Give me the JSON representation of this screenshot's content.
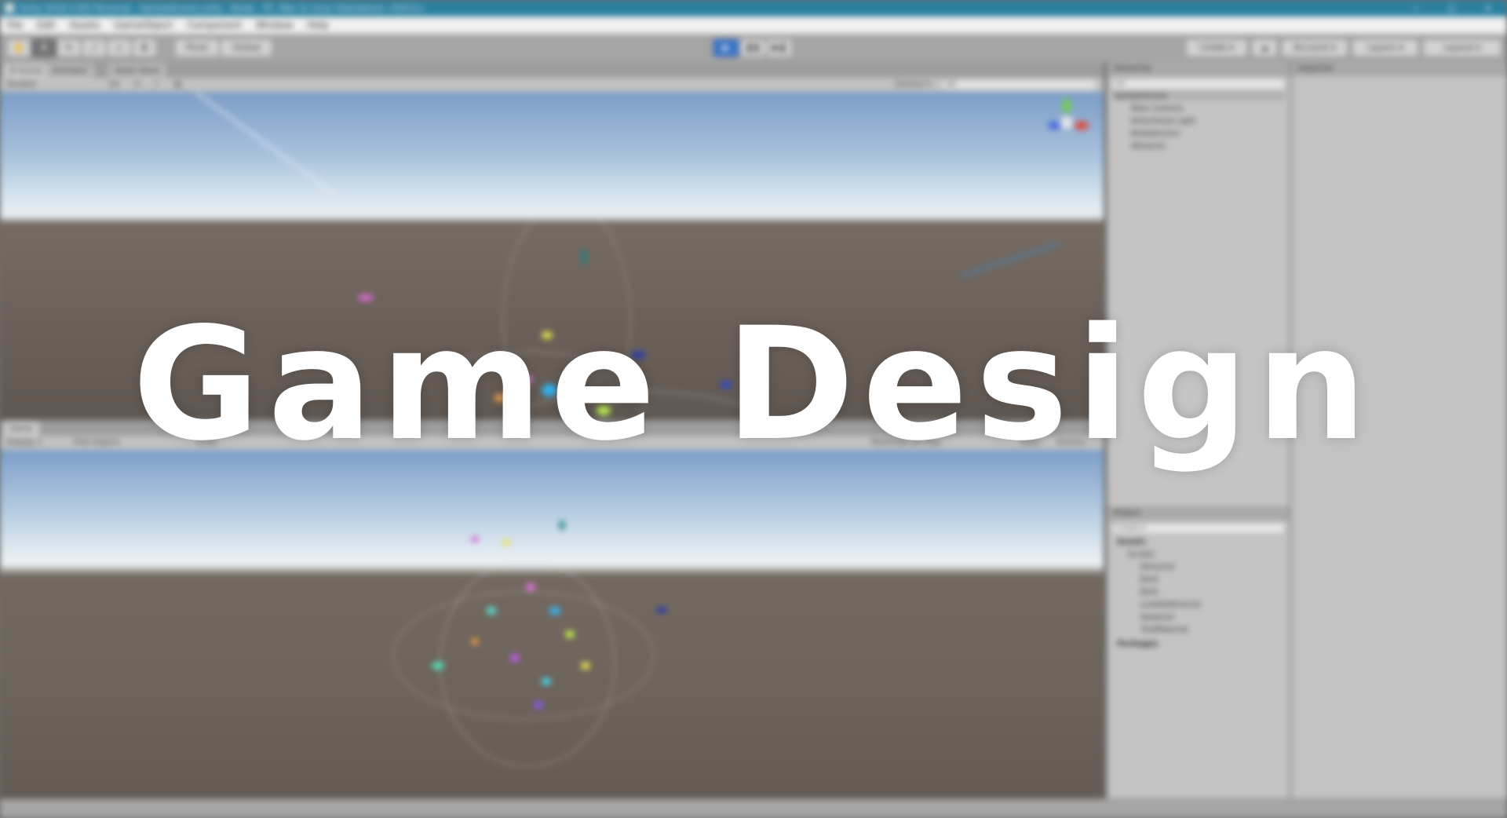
{
  "window": {
    "title": "Unity 2018.3.0f2 Personal - SampleScene.unity - Boids - PC, Mac & Linux Standalone <DX11>",
    "controls": [
      "—",
      "□",
      "✕"
    ]
  },
  "menu": [
    "File",
    "Edit",
    "Assets",
    "GameObject",
    "Component",
    "Window",
    "Help"
  ],
  "toolbar": {
    "pivot_label": "Pivot",
    "global_label": "Global",
    "collab_label": "Collab ▾",
    "account_label": "Account ▾",
    "layers_label": "Layers ▾",
    "layout_label": "Layout ▾"
  },
  "scene_panel": {
    "tabs": [
      "# Scene",
      "Animator",
      "Asset Store"
    ],
    "shading_mode": "Shaded",
    "mode_2d": "2D",
    "gizmos_label": "Gizmos ▾",
    "search_placeholder": "All"
  },
  "game_panel": {
    "tab": "Game",
    "display": "Display 1",
    "aspect": "Free Aspect",
    "scale_label": "Scale",
    "maximize_label": "Maximize On Play",
    "stats_label": "Stats",
    "gizmos_label": "Gizmos"
  },
  "hierarchy": {
    "tab": "Hierarchy",
    "create_label": "Create ▾",
    "search_placeholder": "All",
    "scene_name": "SampleScene",
    "items": [
      "Main Camera",
      "Directional Light",
      "BoidsAnchor",
      "Attractor"
    ]
  },
  "inspector": {
    "tab": "Inspector"
  },
  "project": {
    "tab": "Project",
    "create_label": "Create ▾",
    "root": "Assets",
    "folder": "Scripts",
    "items": [
      "Attractor",
      "Boid",
      "Boid",
      "LookAtAttractor",
      "Spawner",
      "TrailMaterial"
    ],
    "packages": "Packages"
  },
  "overlay_title": "Game Design",
  "colors": {
    "titlebar": "#2a7fa0",
    "overlay_text": "#ffffff",
    "play_button": "#3a74c8"
  }
}
